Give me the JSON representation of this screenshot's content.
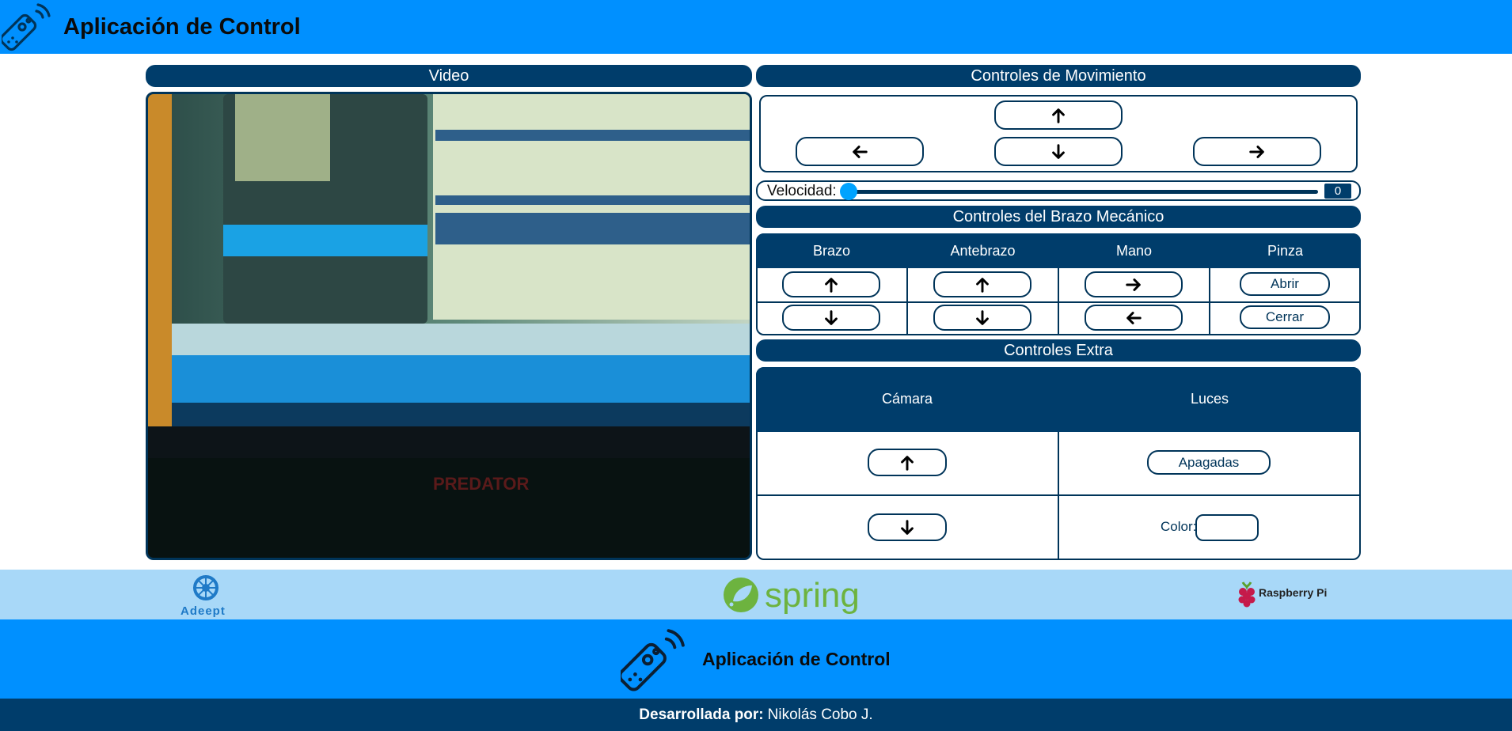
{
  "header": {
    "title": "Aplicación de Control",
    "logo_icon": "remote-control-icon"
  },
  "video": {
    "title": "Video"
  },
  "movement": {
    "title": "Controles de Movimiento"
  },
  "speed": {
    "label": "Velocidad:",
    "value": "0"
  },
  "arm": {
    "title": "Controles del Brazo Mecánico",
    "columns": [
      "Brazo",
      "Antebrazo",
      "Mano",
      "Pinza"
    ],
    "grip_open": "Abrir",
    "grip_close": "Cerrar"
  },
  "extras": {
    "title": "Controles Extra",
    "columns": [
      "Cámara",
      "Luces"
    ],
    "lights_state": "Apagadas",
    "color_label": "Color:"
  },
  "partners": {
    "adeept": "Adeept",
    "spring": "spring",
    "raspberry": "Raspberry Pi"
  },
  "footer": {
    "title": "Aplicación de Control",
    "credit_label": "Desarrollada por:",
    "credit_name": "Nikolás Cobo J."
  },
  "colors": {
    "primary": "#0090ff",
    "dark": "#003d6b",
    "strip": "#a8d8f8",
    "accent": "#00a3ff"
  }
}
